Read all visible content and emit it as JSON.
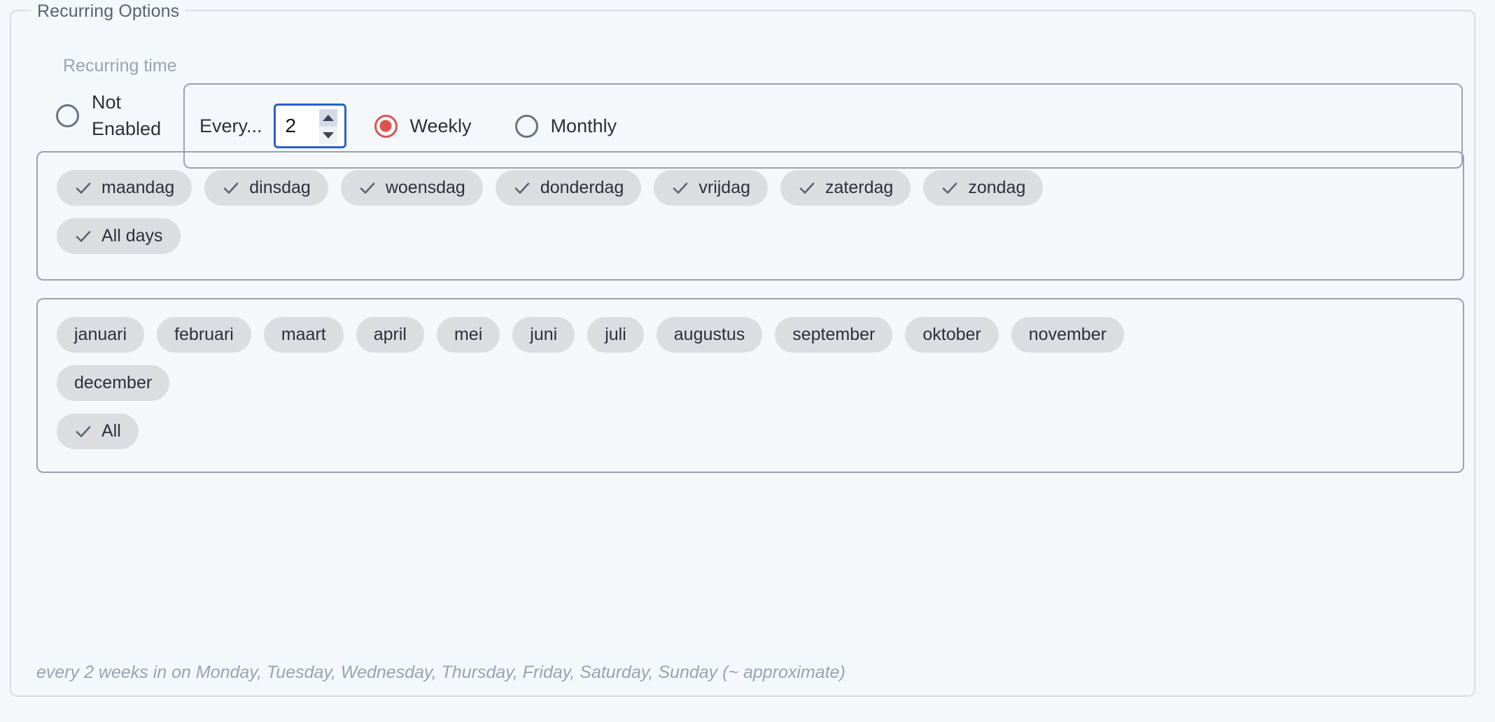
{
  "fieldset": {
    "legend": "Recurring Options"
  },
  "recurring": {
    "section_label": "Recurring time",
    "not_enabled": {
      "label": "Not Enabled",
      "selected": false
    },
    "every": {
      "label": "Every...",
      "value": "2",
      "spin_up_icon": "chevron-up-icon",
      "spin_down_icon": "chevron-down-icon"
    },
    "frequency_options": [
      {
        "label": "Weekly",
        "selected": true
      },
      {
        "label": "Monthly",
        "selected": false
      }
    ]
  },
  "days": {
    "chips": [
      {
        "label": "maandag",
        "checked": true
      },
      {
        "label": "dinsdag",
        "checked": true
      },
      {
        "label": "woensdag",
        "checked": true
      },
      {
        "label": "donderdag",
        "checked": true
      },
      {
        "label": "vrijdag",
        "checked": true
      },
      {
        "label": "zaterdag",
        "checked": true
      },
      {
        "label": "zondag",
        "checked": true
      }
    ],
    "all_chip": {
      "label": "All days",
      "checked": true
    }
  },
  "months": {
    "chips": [
      {
        "label": "januari",
        "checked": false
      },
      {
        "label": "februari",
        "checked": false
      },
      {
        "label": "maart",
        "checked": false
      },
      {
        "label": "april",
        "checked": false
      },
      {
        "label": "mei",
        "checked": false
      },
      {
        "label": "juni",
        "checked": false
      },
      {
        "label": "juli",
        "checked": false
      },
      {
        "label": "augustus",
        "checked": false
      },
      {
        "label": "september",
        "checked": false
      },
      {
        "label": "oktober",
        "checked": false
      },
      {
        "label": "november",
        "checked": false
      },
      {
        "label": "december",
        "checked": false
      }
    ],
    "all_chip": {
      "label": "All",
      "checked": true
    }
  },
  "summary": {
    "text": "every 2 weeks in on Monday, Tuesday, Wednesday, Thursday, Friday, Saturday, Sunday (~ approximate)"
  },
  "colors": {
    "background": "#f5f8fa",
    "panel_border": "#9ba1ad",
    "fieldset_border": "#d8dde6",
    "chip_bg": "#dcdde1",
    "accent_radio": "#d9534f",
    "focus_border": "#2962c4",
    "muted_text": "#9aa3b2",
    "text": "#2b303b"
  }
}
